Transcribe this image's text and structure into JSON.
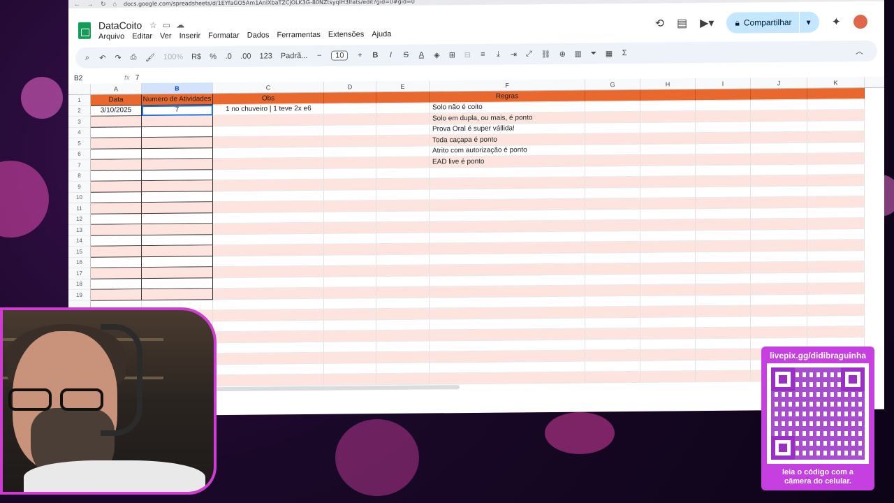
{
  "browser": {
    "url": "docs.google.com/spreadsheets/d/1EYfaGO5Am1AnlXbaTZCjOLK3G-80NZtsyqIH3Ifats/edit?gid=0#gid=0"
  },
  "doc": {
    "title": "DataCoito"
  },
  "menu": [
    "Arquivo",
    "Editar",
    "Ver",
    "Inserir",
    "Formatar",
    "Dados",
    "Ferramentas",
    "Extensões",
    "Ajuda"
  ],
  "actions": {
    "share_label": "Compartilhar"
  },
  "toolbar": {
    "zoom": "100%",
    "currency": "R$",
    "percent": "%",
    "dec_decrease": ".0",
    "dec_increase": ".00",
    "number_format": "123",
    "font": "Padrã...",
    "font_size": "10",
    "bold": "B",
    "italic": "I",
    "strike": "S",
    "text_color": "A"
  },
  "formula_bar": {
    "cell_ref": "B2",
    "fx": "fx",
    "value": "7"
  },
  "columns": [
    "A",
    "B",
    "C",
    "D",
    "E",
    "F",
    "G",
    "H",
    "I",
    "J",
    "K"
  ],
  "header_row": {
    "a": "Data",
    "b": "Numero de Atividades",
    "c": "Obs",
    "f": "Regras"
  },
  "data_row": {
    "a": "3/10/2025",
    "b": "7",
    "c": "1 no chuveiro  | 1 teve 2x e6",
    "f": "Solo não é coito"
  },
  "rules": [
    "Solo em dupla, ou mais, é ponto",
    "Prova Oral é super vállida!",
    "Toda caçapa é ponto",
    "Atrito com autorização é ponto",
    "EAD live é ponto"
  ],
  "row_numbers": [
    "1",
    "2",
    "3",
    "4",
    "5",
    "6",
    "7",
    "8",
    "9",
    "10",
    "11",
    "12",
    "13",
    "14",
    "15",
    "16",
    "17",
    "18",
    "19"
  ],
  "overlay": {
    "qr_top": "livepix.gg/didibraguinha",
    "qr_bottom_1": "leia o código com a",
    "qr_bottom_2": "câmera do celular."
  },
  "colors": {
    "header_orange": "#e8682e",
    "band_pink": "#fde4de",
    "overlay_magenta": "#c63fe0"
  }
}
